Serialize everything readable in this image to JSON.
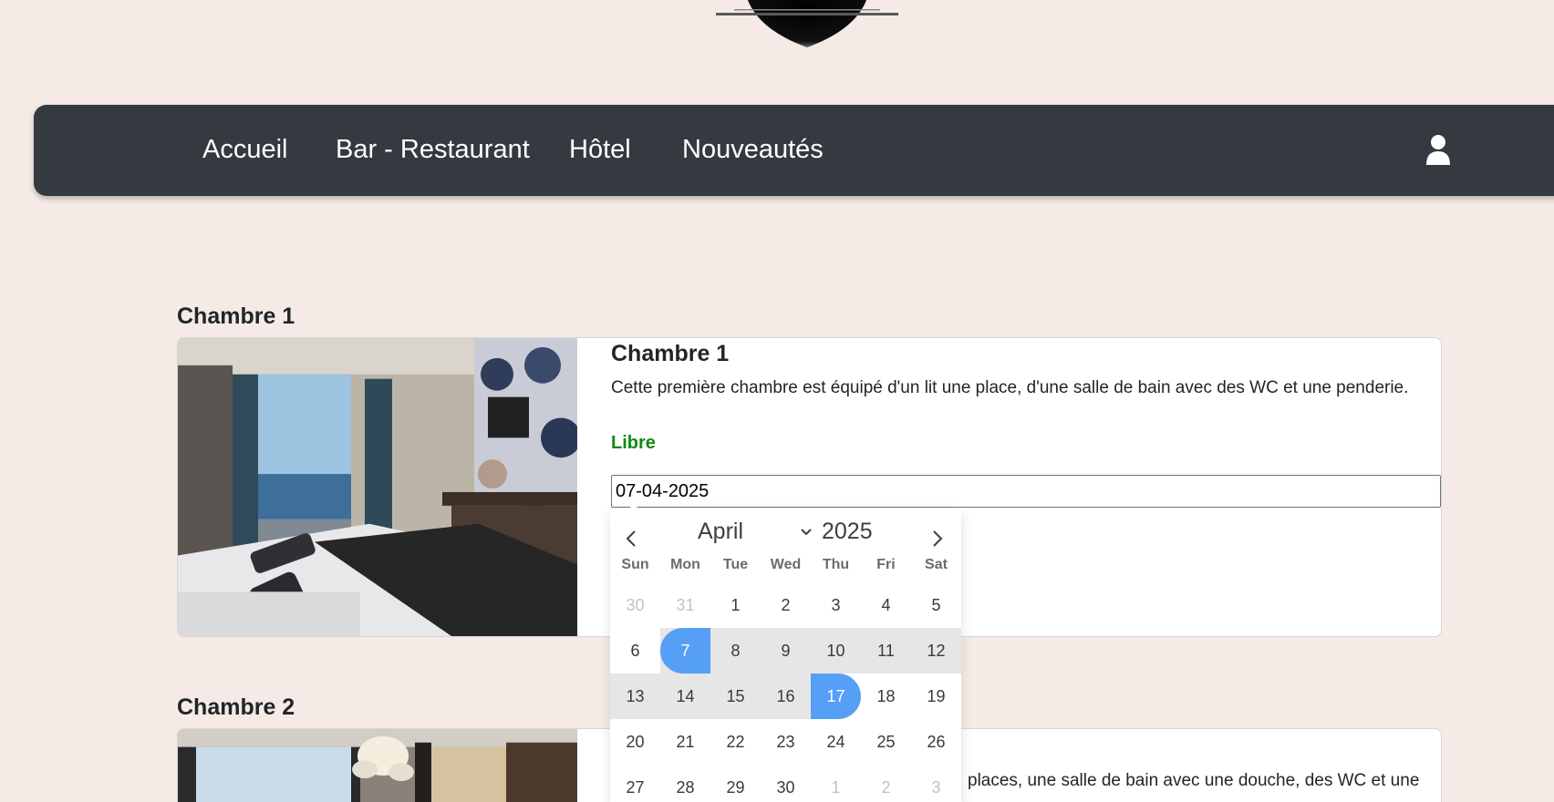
{
  "nav": {
    "items": [
      "Accueil",
      "Bar - Restaurant",
      "Hôtel",
      "Nouveautés"
    ],
    "user_icon": "user-icon"
  },
  "rooms": [
    {
      "heading": "Chambre 1",
      "title": "Chambre 1",
      "description": "Cette première chambre est équipé d'un lit une place, d'une salle de bain avec des WC et une penderie.",
      "status": "Libre",
      "date_value": "07-04-2025"
    },
    {
      "heading": "Chambre 2",
      "description_fragment": "places, une salle de bain avec une douche, des WC et une"
    }
  ],
  "calendar": {
    "month": "April",
    "year": "2025",
    "weekdays": [
      "Sun",
      "Mon",
      "Tue",
      "Wed",
      "Thu",
      "Fri",
      "Sat"
    ],
    "weeks": [
      [
        "30",
        "31",
        "1",
        "2",
        "3",
        "4",
        "5"
      ],
      [
        "6",
        "7",
        "8",
        "9",
        "10",
        "11",
        "12"
      ],
      [
        "13",
        "14",
        "15",
        "16",
        "17",
        "18",
        "19"
      ],
      [
        "20",
        "21",
        "22",
        "23",
        "24",
        "25",
        "26"
      ],
      [
        "27",
        "28",
        "29",
        "30",
        "1",
        "2",
        "3"
      ]
    ],
    "range_start": "7",
    "range_end": "17",
    "accent_color": "#569ff7"
  },
  "colors": {
    "background": "#f5eae5",
    "navbar": "#343a40",
    "status_free": "#118a14"
  }
}
